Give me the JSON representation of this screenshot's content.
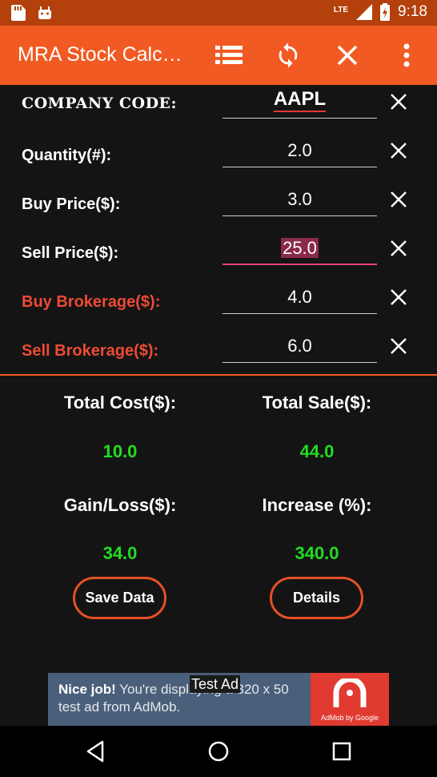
{
  "status_bar": {
    "time": "9:18",
    "network": "LTE",
    "icons": [
      "sd-card-icon",
      "android-icon",
      "signal-icon",
      "battery-charging-icon"
    ]
  },
  "app_bar": {
    "title": "MRA Stock Calculator",
    "actions": [
      "list-icon",
      "refresh-icon",
      "close-icon",
      "more-vert-icon"
    ]
  },
  "form": {
    "rows": [
      {
        "label": "COMPANY CODE:",
        "value": "AAPL"
      },
      {
        "label": "Quantity(#):",
        "value": "2.0"
      },
      {
        "label": "Buy Price($):",
        "value": "3.0"
      },
      {
        "label": "Sell Price($):",
        "value": "25.0"
      },
      {
        "label": "Buy Brokerage($):",
        "value": "4.0"
      },
      {
        "label": "Sell Brokerage($):",
        "value": "6.0"
      }
    ]
  },
  "results": {
    "total_cost_label": "Total Cost($):",
    "total_cost_value": "10.0",
    "total_sale_label": "Total Sale($):",
    "total_sale_value": "44.0",
    "gain_loss_label": "Gain/Loss($):",
    "gain_loss_value": "34.0",
    "increase_label": "Increase (%):",
    "increase_value": "340.0"
  },
  "buttons": {
    "save": "Save Data",
    "details": "Details"
  },
  "ad": {
    "headline": "Nice job!",
    "body": "You're displaying a 320 x 50 test ad from AdMob.",
    "overlay": "Test Ad",
    "brand": "AdMob by Google"
  },
  "colors": {
    "accent": "#f15a22",
    "status_bar": "#b4400c",
    "value_green": "#22dd22",
    "warn_label": "#ec4b34",
    "focus": "#ec407a"
  }
}
